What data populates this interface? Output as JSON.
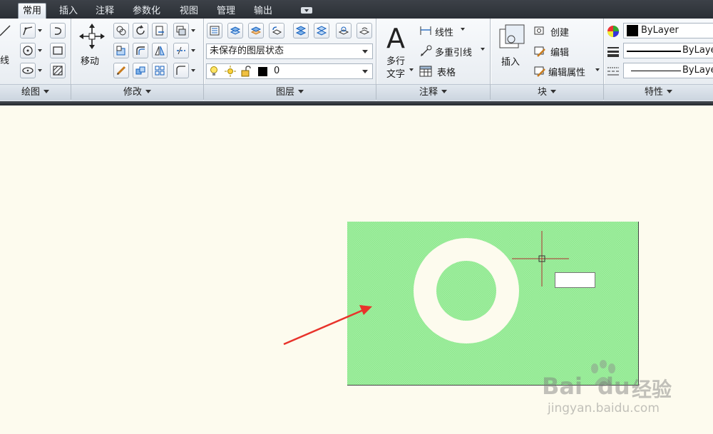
{
  "tabs": [
    "常用",
    "插入",
    "注释",
    "参数化",
    "视图",
    "管理",
    "输出"
  ],
  "active_tab": "常用",
  "panels": {
    "draw": {
      "title": "绘图",
      "line_label": "线"
    },
    "modify": {
      "title": "修改",
      "move_label": "移动"
    },
    "layers": {
      "title": "图层",
      "state_combo": "未保存的图层状态",
      "layer_combo": "0"
    },
    "annotation": {
      "title": "注释",
      "mtext_label_1": "多行",
      "mtext_label_2": "文字",
      "linear_label": "线性",
      "mleader_label": "多重引线",
      "table_label": "表格"
    },
    "block": {
      "title": "块",
      "insert_label": "插入",
      "create_label": "创建",
      "edit_label": "编辑",
      "edit_attr_label": "编辑属性"
    },
    "properties": {
      "title": "特性",
      "color_combo": "ByLayer",
      "lineweight_combo": "ByLayer",
      "linetype_combo": "ByLayer"
    }
  },
  "watermark": {
    "brand": "Bai",
    "brand_suffix": "du",
    "cn": "经验",
    "url": "jingyan.baidu.com"
  },
  "colors": {
    "hatch_fill": "#8ee98e",
    "canvas_bg": "#fdfbee",
    "arrow": "#e8332b"
  }
}
